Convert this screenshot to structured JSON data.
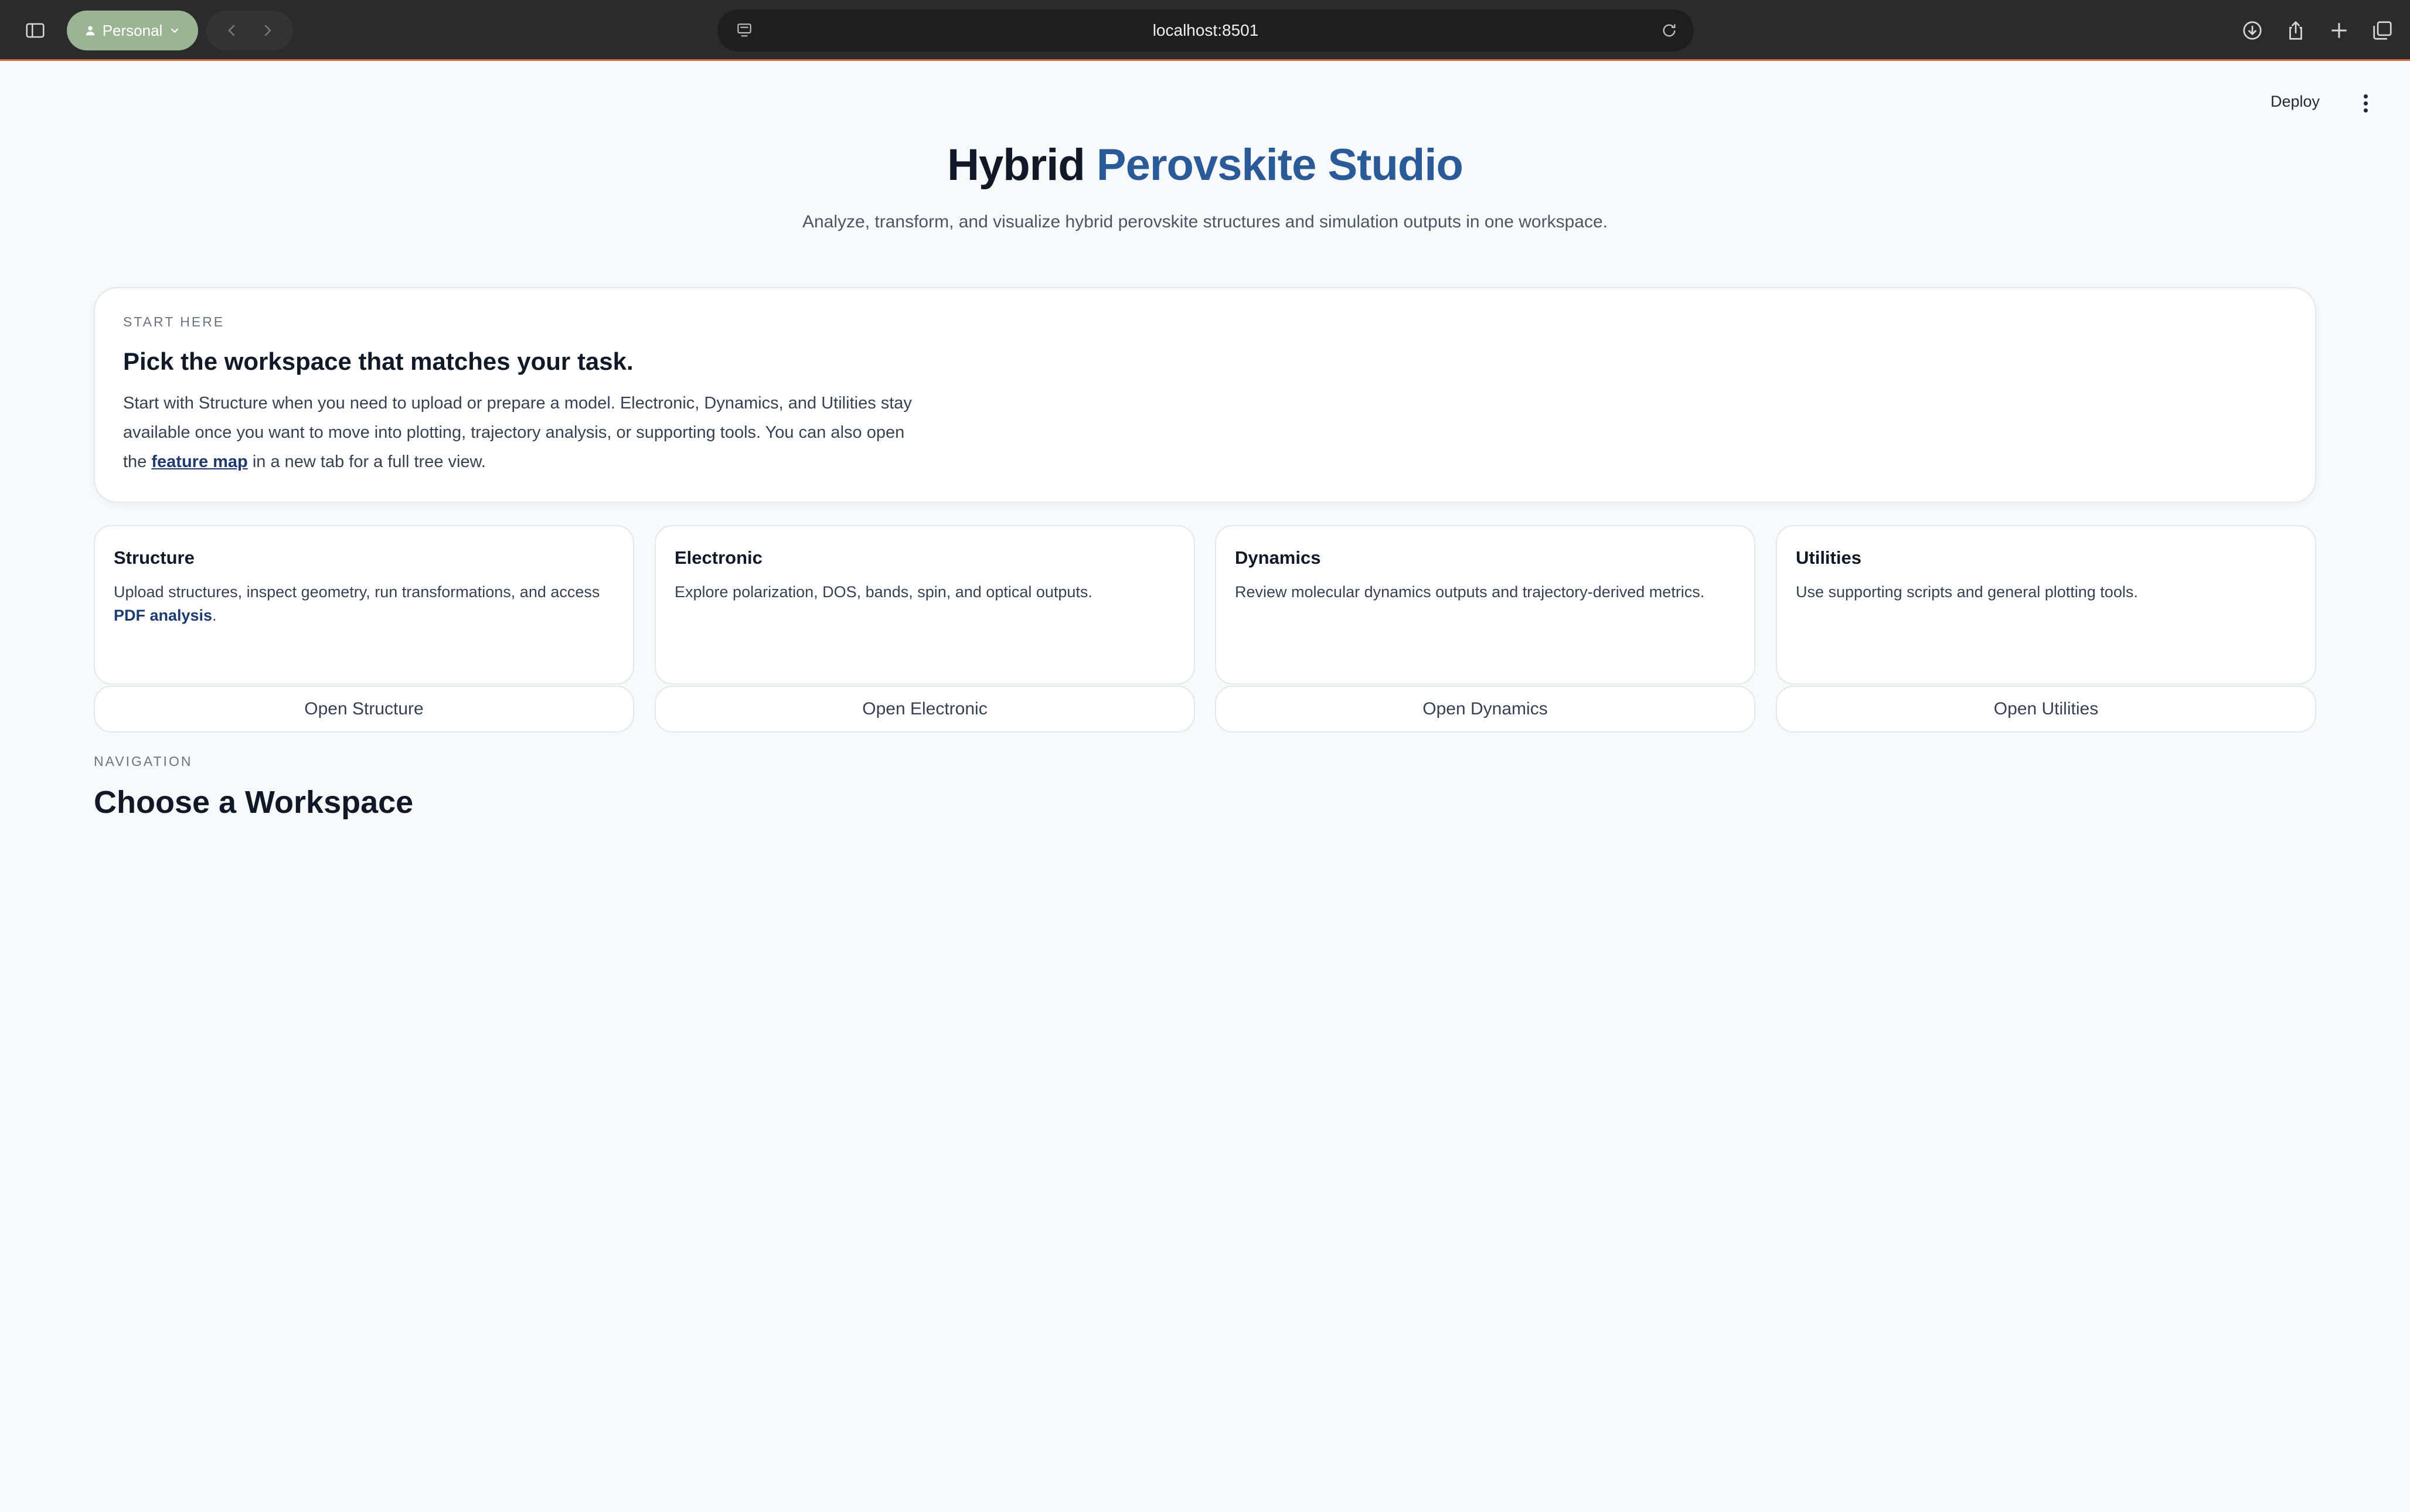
{
  "browser": {
    "profile_label": "Personal",
    "url": "localhost:8501",
    "icons": [
      "sidebar-icon",
      "person-icon",
      "chevron-down-icon",
      "back-icon",
      "forward-icon",
      "site-settings-icon",
      "reload-icon",
      "download-icon",
      "share-icon",
      "new-tab-icon",
      "tabs-overview-icon"
    ]
  },
  "app_header": {
    "deploy_label": "Deploy",
    "menu_icon": "kebab-menu-icon"
  },
  "hero": {
    "title_plain": "Hybrid",
    "title_accent": "Perovskite Studio",
    "subtitle": "Analyze, transform, and visualize hybrid perovskite structures and simulation outputs in one workspace.",
    "accent_color": "#2b5a98"
  },
  "start_here": {
    "eyebrow": "START HERE",
    "heading": "Pick the workspace that matches your task.",
    "body_before_link": "Start with Structure when you need to upload or prepare a model. Electronic, Dynamics, and Utilities stay available once you want to move into plotting, trajectory analysis, or supporting tools. You can also open the ",
    "link_text": "feature map",
    "body_after_link": " in a new tab for a full tree view."
  },
  "workspaces": [
    {
      "title": "Structure",
      "desc": "Upload structures, inspect geometry, run transformations, and access ",
      "link": "PDF analysis",
      "desc_end": ".",
      "button": "Open Structure"
    },
    {
      "title": "Electronic",
      "desc": "Explore polarization, DOS, bands, spin, and optical outputs.",
      "button": "Open Electronic"
    },
    {
      "title": "Dynamics",
      "desc": "Review molecular dynamics outputs and trajectory-derived metrics.",
      "button": "Open Dynamics"
    },
    {
      "title": "Utilities",
      "desc": "Use supporting scripts and general plotting tools.",
      "button": "Open Utilities"
    }
  ],
  "navigation": {
    "eyebrow": "NAVIGATION",
    "heading": "Choose a Workspace"
  }
}
